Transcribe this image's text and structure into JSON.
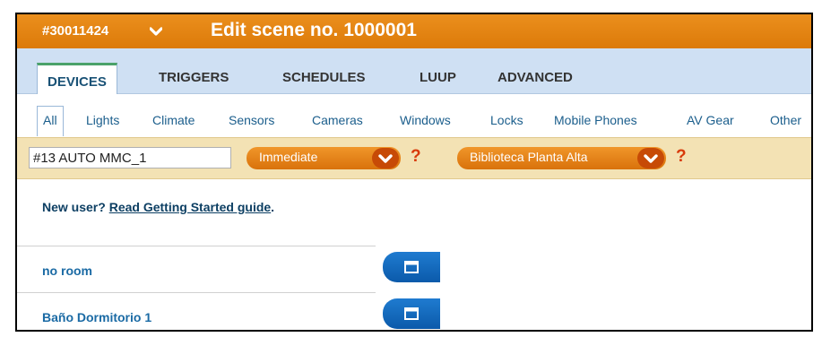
{
  "header": {
    "unit_id": "#30011424",
    "scene_title": "Edit scene no. 1000001",
    "chevron_icon": "chevron-down-icon"
  },
  "tabs": [
    {
      "label": "DEVICES",
      "active": true
    },
    {
      "label": "TRIGGERS",
      "active": false
    },
    {
      "label": "SCHEDULES",
      "active": false
    },
    {
      "label": "LUUP",
      "active": false
    },
    {
      "label": "ADVANCED",
      "active": false
    }
  ],
  "categories": [
    {
      "label": "All",
      "active": true
    },
    {
      "label": "Lights"
    },
    {
      "label": "Climate"
    },
    {
      "label": "Sensors"
    },
    {
      "label": "Cameras"
    },
    {
      "label": "Windows"
    },
    {
      "label": "Locks"
    },
    {
      "label": "Mobile Phones"
    },
    {
      "label": "AV Gear"
    },
    {
      "label": "Other"
    }
  ],
  "filters": {
    "device_name_value": "#13 AUTO MMC_1",
    "delay_select": "Immediate",
    "room_select": "Biblioteca Planta Alta",
    "help_label": "?"
  },
  "intro": {
    "prefix": "New user? ",
    "link": "Read Getting Started guide",
    "suffix": "."
  },
  "rooms": [
    {
      "label": "no room",
      "button_icon": "window-icon"
    },
    {
      "label": "Baño Dormitorio 1",
      "button_icon": "window-icon"
    }
  ],
  "colors": {
    "title_bar": "#e2830f",
    "tabs_background": "#cfe0f3",
    "filter_background": "#f3e2b4",
    "pill_orange": "#e4800f",
    "room_button_blue": "#1467bd",
    "link_blue": "#1a6aa4"
  }
}
